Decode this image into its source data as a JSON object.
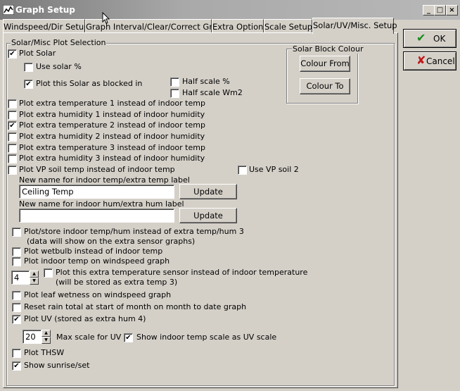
{
  "window": {
    "title": "Graph Setup"
  },
  "tabs": [
    "Windspeed/Dir Setup",
    "Graph Interval/Clear/Correct Graph",
    "Extra Options",
    "Scale Setup",
    "Solar/UV/Misc. Setup"
  ],
  "side_buttons": {
    "ok": "OK",
    "cancel": "Cancel"
  },
  "group": {
    "title": "Solar/Misc Plot Selection"
  },
  "solar": {
    "plot_solar": {
      "label": "Plot Solar",
      "checked": true
    },
    "use_solar_pct": {
      "label": "Use solar %",
      "checked": false
    },
    "plot_blocked": {
      "label": "Plot this Solar as blocked in",
      "checked": true
    },
    "half_scale_pct": {
      "label": "Half scale %",
      "checked": false
    },
    "half_scale_wm2": {
      "label": "Half scale Wm2",
      "checked": false
    }
  },
  "solar_block": {
    "title": "Solar Block Colour",
    "colour_from": "Colour From",
    "colour_to": "Colour To"
  },
  "extra_options": [
    {
      "label": "Plot extra temperature 1 instead of indoor temp",
      "checked": false
    },
    {
      "label": "Plot extra humidity 1 instead of indoor humidity",
      "checked": false
    },
    {
      "label": "Plot extra temperature 2 instead of indoor temp",
      "checked": true
    },
    {
      "label": "Plot extra humidity 2 instead of indoor humidity",
      "checked": false
    },
    {
      "label": "Plot extra temperature 3 instead of indoor temp",
      "checked": false
    },
    {
      "label": "Plot extra humidity 3 instead of indoor humidity",
      "checked": false
    },
    {
      "label": "Plot VP soil temp instead of indoor temp",
      "checked": false
    }
  ],
  "use_vp_soil2": {
    "label": "Use VP soil 2",
    "checked": false
  },
  "rename_temp": {
    "label": "New name for indoor temp/extra temp label",
    "value": "Ceiling Temp",
    "button": "Update"
  },
  "rename_hum": {
    "label": "New name for indoor hum/extra hum label",
    "value": "",
    "button": "Update"
  },
  "store_indoor": {
    "label": "Plot/store indoor temp/hum instead of extra temp/hum 3",
    "note": "(data will show on the extra sensor graphs)",
    "checked": false
  },
  "plot_wetbulb": {
    "label": "Plot wetbulb instead of indoor temp",
    "checked": false
  },
  "plot_indoor_wind": {
    "label": "Plot indoor temp on windspeed graph",
    "checked": false
  },
  "extra_sensor": {
    "spin_value": "4",
    "label": "Plot this extra temperature sensor instead of indoor temperature",
    "note": "(will be stored as extra temp 3)",
    "checked": false
  },
  "plot_leaf": {
    "label": "Plot leaf wetness on windspeed graph",
    "checked": false
  },
  "reset_rain": {
    "label": "Reset rain total at start of month on month to date graph",
    "checked": false
  },
  "plot_uv": {
    "label": "Plot UV (stored as extra hum 4)",
    "checked": true
  },
  "uv_scale": {
    "spin_value": "20",
    "label": "Max scale for UV"
  },
  "show_indoor_uv": {
    "label": "Show indoor temp scale as UV scale",
    "checked": true
  },
  "plot_thsw": {
    "label": "Plot THSW",
    "checked": false
  },
  "show_sunrise": {
    "label": "Show sunrise/set",
    "checked": true
  },
  "glyphs": {
    "check": "✔",
    "arrow_up": "▲",
    "arrow_down": "▼",
    "minimize": "_",
    "maximize": "□",
    "close": "×",
    "ok_icon": "✔",
    "cancel_icon": "✘"
  },
  "colors": {
    "ok_icon": "#1a8a1a",
    "cancel_icon": "#c01818"
  }
}
